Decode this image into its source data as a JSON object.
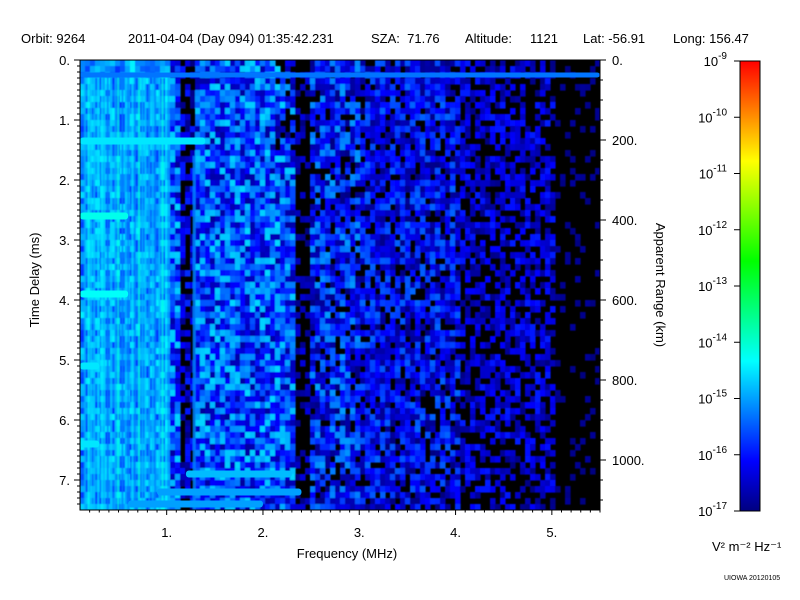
{
  "header": {
    "orbit": "Orbit: 9264",
    "datetime": "2011-04-04 (Day 094) 01:35:42.231",
    "sza": "SZA:  71.76",
    "altitude": "Altitude:     1121",
    "lat": "Lat: -56.91",
    "long": "Long: 156.47"
  },
  "credit": "UIOWA 20120105",
  "chart_data": {
    "type": "heatmap",
    "xlabel": "Frequency (MHz)",
    "ylabel": "Time Delay (ms)",
    "y2label": "Apparent Range (km)",
    "xlim": [
      0.1,
      5.5
    ],
    "ylim": [
      0,
      7.5
    ],
    "y2lim": [
      0,
      1125
    ],
    "x_ticks": [
      {
        "value": 1,
        "label": "1."
      },
      {
        "value": 2,
        "label": "2."
      },
      {
        "value": 3,
        "label": "3."
      },
      {
        "value": 4,
        "label": "4."
      },
      {
        "value": 5,
        "label": "5."
      }
    ],
    "y_ticks": [
      {
        "value": 0,
        "label": "0."
      },
      {
        "value": 1,
        "label": "1."
      },
      {
        "value": 2,
        "label": "2."
      },
      {
        "value": 3,
        "label": "3."
      },
      {
        "value": 4,
        "label": "4."
      },
      {
        "value": 5,
        "label": "5."
      },
      {
        "value": 6,
        "label": "6."
      },
      {
        "value": 7,
        "label": "7."
      }
    ],
    "y2_ticks": [
      {
        "value": 0,
        "label": "0."
      },
      {
        "value": 200,
        "label": "200."
      },
      {
        "value": 400,
        "label": "400."
      },
      {
        "value": 600,
        "label": "600."
      },
      {
        "value": 800,
        "label": "800."
      },
      {
        "value": 1000,
        "label": "1000."
      }
    ],
    "colorbar": {
      "scale": "log",
      "range": [
        1e-17,
        1e-09
      ],
      "unit": "V² m⁻² Hz⁻¹",
      "ticks": [
        {
          "base": "10",
          "exp": "-9"
        },
        {
          "base": "10",
          "exp": "-10"
        },
        {
          "base": "10",
          "exp": "-11"
        },
        {
          "base": "10",
          "exp": "-12"
        },
        {
          "base": "10",
          "exp": "-13"
        },
        {
          "base": "10",
          "exp": "-14"
        },
        {
          "base": "10",
          "exp": "-15"
        },
        {
          "base": "10",
          "exp": "-16"
        },
        {
          "base": "10",
          "exp": "-17"
        }
      ],
      "colors": [
        "#000080",
        "#0000ff",
        "#0080ff",
        "#00ffff",
        "#00ff80",
        "#00ff00",
        "#80ff00",
        "#ffff00",
        "#ff8000",
        "#ff0000"
      ]
    },
    "features": [
      {
        "name": "surface-reflection",
        "delay_ms": 0.25,
        "freq_range_mhz": [
          0.1,
          5.5
        ],
        "level": -15.3
      },
      {
        "name": "plasma-resonance-1",
        "delay_ms": 1.35,
        "freq_range_mhz": [
          0.1,
          1.4
        ],
        "level": -14.5
      },
      {
        "name": "plasma-resonance-2",
        "delay_ms": 2.6,
        "freq_range_mhz": [
          0.1,
          0.6
        ],
        "level": -14.2
      },
      {
        "name": "plasma-resonance-3",
        "delay_ms": 3.9,
        "freq_range_mhz": [
          0.1,
          0.6
        ],
        "level": -14.3
      },
      {
        "name": "plasma-resonance-4",
        "delay_ms": 5.1,
        "freq_range_mhz": [
          0.1,
          0.3
        ],
        "level": -14.5
      },
      {
        "name": "plasma-resonance-5",
        "delay_ms": 6.4,
        "freq_range_mhz": [
          0.1,
          0.3
        ],
        "level": -14.5
      },
      {
        "name": "bottom-echo-1",
        "delay_ms": 6.9,
        "freq_range_mhz": [
          1.2,
          2.3
        ],
        "level": -14.8
      },
      {
        "name": "bottom-echo-2",
        "delay_ms": 7.2,
        "freq_range_mhz": [
          0.9,
          2.4
        ],
        "level": -15.0
      },
      {
        "name": "bottom-echo-3",
        "delay_ms": 7.4,
        "freq_range_mhz": [
          0.6,
          2.0
        ],
        "level": -15.0
      }
    ]
  }
}
